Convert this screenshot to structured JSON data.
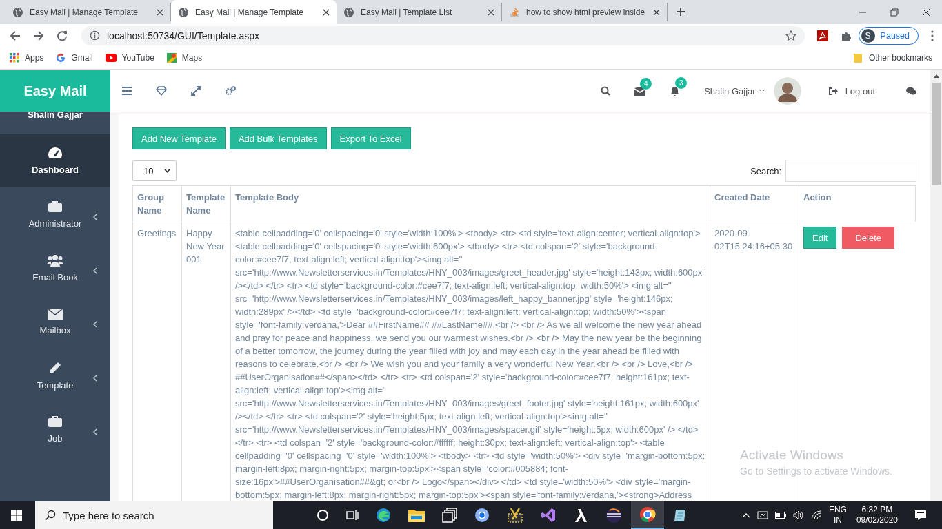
{
  "browser": {
    "tabs": [
      {
        "title": "Easy Mail | Manage Template",
        "selected": false
      },
      {
        "title": "Easy Mail | Manage Template",
        "selected": true
      },
      {
        "title": "Easy Mail | Template List",
        "selected": false
      },
      {
        "title": "how to show html preview inside",
        "selected": false
      }
    ],
    "address": "localhost:50734/GUI/Template.aspx",
    "profile": {
      "initial": "S",
      "status": "Paused"
    },
    "bookmarks": [
      "Apps",
      "Gmail",
      "YouTube",
      "Maps"
    ],
    "other_bookmarks": "Other bookmarks"
  },
  "app": {
    "brand": "Easy Mail",
    "user": "Shalin Gajjar",
    "nav": [
      {
        "label": "Dashboard",
        "selected": true,
        "has_submenu": false
      },
      {
        "label": "Administrator",
        "selected": false,
        "has_submenu": true
      },
      {
        "label": "Email Book",
        "selected": false,
        "has_submenu": true
      },
      {
        "label": "Mailbox",
        "selected": false,
        "has_submenu": true
      },
      {
        "label": "Template",
        "selected": false,
        "has_submenu": true
      },
      {
        "label": "Job",
        "selected": false,
        "has_submenu": true
      }
    ],
    "topbar": {
      "mail_badge": "4",
      "bell_badge": "3",
      "user_menu": "Shalin Gajjar",
      "logout": "Log out"
    },
    "buttons": [
      "Add New Template",
      "Add Bulk Templates",
      "Export To Excel"
    ],
    "page_length": "10",
    "search_label": "Search:",
    "table": {
      "columns": [
        "Group Name",
        "Template Name",
        "Template Body",
        "Created Date",
        "Action"
      ],
      "rows": [
        {
          "group": "Greetings",
          "name": "Happy New Year 001",
          "body": "<table cellpadding='0' cellspacing='0' style='width:100%'> <tbody> <tr> <td style='text-align:center; vertical-align:top'> <table cellpadding='0' cellspacing='0' style='width:600px'> <tbody> <tr> <td colspan='2' style='background-color:#cee7f7; text-align:left; vertical-align:top'><img alt='' src='http://www.Newsletterservices.in/Templates/HNY_003/images/greet_header.jpg' style='height:143px; width:600px' /></td> </tr> <tr> <td style='background-color:#cee7f7; text-align:left; vertical-align:top; width:50%'> <img alt='' src='http://www.Newsletterservices.in/Templates/HNY_003/images/left_happy_banner.jpg' style='height:146px; width:289px' /></td> <td style='background-color:#cee7f7; text-align:left; vertical-align:top; width:50%'><span style='font-family:verdana,'>Dear ##FirstName## ##LastName##,<br /> <br /> As we all welcome the new year ahead and pray for peace and happiness, we send you our warmest wishes.<br /> <br /> May the new year be the beginning of a better tomorrow, the journey during the year filled with joy and may each day in the year ahead be filled with reasons to celebrate.<br /> <br /> We wish you and your family a very wonderful New Year.<br /> <br /> Love,<br /> ##UserOrganisation##</span></td> </tr> <tr> <td colspan='2' style='background-color:#cee7f7; height:161px; text-align:left; vertical-align:top'><img alt='' src='http://www.Newsletterservices.in/Templates/HNY_003/images/greet_footer.jpg' style='height:161px; width:600px' /></td> </tr> <tr> <td colspan='2' style='height:5px; text-align:left; vertical-align:top'><img alt='' src='http://www.Newsletterservices.in/Templates/HNY_003/images/spacer.gif' style='height:5px; width:600px' /> </td> </tr> <tr> <td colspan='2' style='background-color:#ffffff; height:30px; text-align:left; vertical-align:top'> <table cellpadding='0' cellspacing='0' style='width:100%'> <tbody> <tr> <td style='width:50%'> <div style='margin-bottom:5px; margin-left:8px; margin-right:5px; margin-top:5px'><span style='color:#005884; font-size:16px'>##UserOrganisation##&gt; or<br /> Logo</span></div> </td> <td style='width:50%'> <div style='margin-bottom:5px; margin-left:8px; margin-right:5px; margin-top:5px'><span style='font-family:verdana,'><strong>Address",
          "created": "2020-09-02T15:24:16+05:30",
          "actions": [
            "Edit",
            "Delete"
          ]
        }
      ]
    }
  },
  "activation": {
    "title": "Activate Windows",
    "hint": "Go to Settings to activate Windows."
  },
  "taskbar": {
    "search_placeholder": "Type here to search",
    "language": "ENG",
    "region": "IN",
    "time": "6:32 PM",
    "date": "09/02/2020"
  }
}
